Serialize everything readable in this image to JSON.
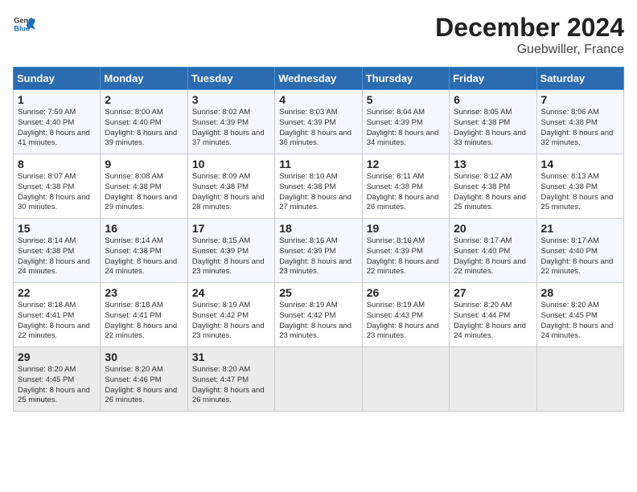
{
  "header": {
    "logo_text_general": "General",
    "logo_text_blue": "Blue",
    "month_title": "December 2024",
    "subtitle": "Guebwiller, France"
  },
  "calendar": {
    "days_of_week": [
      "Sunday",
      "Monday",
      "Tuesday",
      "Wednesday",
      "Thursday",
      "Friday",
      "Saturday"
    ],
    "weeks": [
      [
        {
          "day": "1",
          "sunrise": "Sunrise: 7:59 AM",
          "sunset": "Sunset: 4:40 PM",
          "daylight": "Daylight: 8 hours and 41 minutes."
        },
        {
          "day": "2",
          "sunrise": "Sunrise: 8:00 AM",
          "sunset": "Sunset: 4:40 PM",
          "daylight": "Daylight: 8 hours and 39 minutes."
        },
        {
          "day": "3",
          "sunrise": "Sunrise: 8:02 AM",
          "sunset": "Sunset: 4:39 PM",
          "daylight": "Daylight: 8 hours and 37 minutes."
        },
        {
          "day": "4",
          "sunrise": "Sunrise: 8:03 AM",
          "sunset": "Sunset: 4:39 PM",
          "daylight": "Daylight: 8 hours and 36 minutes."
        },
        {
          "day": "5",
          "sunrise": "Sunrise: 8:04 AM",
          "sunset": "Sunset: 4:39 PM",
          "daylight": "Daylight: 8 hours and 34 minutes."
        },
        {
          "day": "6",
          "sunrise": "Sunrise: 8:05 AM",
          "sunset": "Sunset: 4:38 PM",
          "daylight": "Daylight: 8 hours and 33 minutes."
        },
        {
          "day": "7",
          "sunrise": "Sunrise: 8:06 AM",
          "sunset": "Sunset: 4:38 PM",
          "daylight": "Daylight: 8 hours and 32 minutes."
        }
      ],
      [
        {
          "day": "8",
          "sunrise": "Sunrise: 8:07 AM",
          "sunset": "Sunset: 4:38 PM",
          "daylight": "Daylight: 8 hours and 30 minutes."
        },
        {
          "day": "9",
          "sunrise": "Sunrise: 8:08 AM",
          "sunset": "Sunset: 4:38 PM",
          "daylight": "Daylight: 8 hours and 29 minutes."
        },
        {
          "day": "10",
          "sunrise": "Sunrise: 8:09 AM",
          "sunset": "Sunset: 4:38 PM",
          "daylight": "Daylight: 8 hours and 28 minutes."
        },
        {
          "day": "11",
          "sunrise": "Sunrise: 8:10 AM",
          "sunset": "Sunset: 4:38 PM",
          "daylight": "Daylight: 8 hours and 27 minutes."
        },
        {
          "day": "12",
          "sunrise": "Sunrise: 8:11 AM",
          "sunset": "Sunset: 4:38 PM",
          "daylight": "Daylight: 8 hours and 26 minutes."
        },
        {
          "day": "13",
          "sunrise": "Sunrise: 8:12 AM",
          "sunset": "Sunset: 4:38 PM",
          "daylight": "Daylight: 8 hours and 25 minutes."
        },
        {
          "day": "14",
          "sunrise": "Sunrise: 8:13 AM",
          "sunset": "Sunset: 4:38 PM",
          "daylight": "Daylight: 8 hours and 25 minutes."
        }
      ],
      [
        {
          "day": "15",
          "sunrise": "Sunrise: 8:14 AM",
          "sunset": "Sunset: 4:38 PM",
          "daylight": "Daylight: 8 hours and 24 minutes."
        },
        {
          "day": "16",
          "sunrise": "Sunrise: 8:14 AM",
          "sunset": "Sunset: 4:38 PM",
          "daylight": "Daylight: 8 hours and 24 minutes."
        },
        {
          "day": "17",
          "sunrise": "Sunrise: 8:15 AM",
          "sunset": "Sunset: 4:39 PM",
          "daylight": "Daylight: 8 hours and 23 minutes."
        },
        {
          "day": "18",
          "sunrise": "Sunrise: 8:16 AM",
          "sunset": "Sunset: 4:39 PM",
          "daylight": "Daylight: 8 hours and 23 minutes."
        },
        {
          "day": "19",
          "sunrise": "Sunrise: 8:16 AM",
          "sunset": "Sunset: 4:39 PM",
          "daylight": "Daylight: 8 hours and 22 minutes."
        },
        {
          "day": "20",
          "sunrise": "Sunrise: 8:17 AM",
          "sunset": "Sunset: 4:40 PM",
          "daylight": "Daylight: 8 hours and 22 minutes."
        },
        {
          "day": "21",
          "sunrise": "Sunrise: 8:17 AM",
          "sunset": "Sunset: 4:40 PM",
          "daylight": "Daylight: 8 hours and 22 minutes."
        }
      ],
      [
        {
          "day": "22",
          "sunrise": "Sunrise: 8:18 AM",
          "sunset": "Sunset: 4:41 PM",
          "daylight": "Daylight: 8 hours and 22 minutes."
        },
        {
          "day": "23",
          "sunrise": "Sunrise: 8:18 AM",
          "sunset": "Sunset: 4:41 PM",
          "daylight": "Daylight: 8 hours and 22 minutes."
        },
        {
          "day": "24",
          "sunrise": "Sunrise: 8:19 AM",
          "sunset": "Sunset: 4:42 PM",
          "daylight": "Daylight: 8 hours and 23 minutes."
        },
        {
          "day": "25",
          "sunrise": "Sunrise: 8:19 AM",
          "sunset": "Sunset: 4:42 PM",
          "daylight": "Daylight: 8 hours and 23 minutes."
        },
        {
          "day": "26",
          "sunrise": "Sunrise: 8:19 AM",
          "sunset": "Sunset: 4:43 PM",
          "daylight": "Daylight: 8 hours and 23 minutes."
        },
        {
          "day": "27",
          "sunrise": "Sunrise: 8:20 AM",
          "sunset": "Sunset: 4:44 PM",
          "daylight": "Daylight: 8 hours and 24 minutes."
        },
        {
          "day": "28",
          "sunrise": "Sunrise: 8:20 AM",
          "sunset": "Sunset: 4:45 PM",
          "daylight": "Daylight: 8 hours and 24 minutes."
        }
      ],
      [
        {
          "day": "29",
          "sunrise": "Sunrise: 8:20 AM",
          "sunset": "Sunset: 4:45 PM",
          "daylight": "Daylight: 8 hours and 25 minutes."
        },
        {
          "day": "30",
          "sunrise": "Sunrise: 8:20 AM",
          "sunset": "Sunset: 4:46 PM",
          "daylight": "Daylight: 8 hours and 26 minutes."
        },
        {
          "day": "31",
          "sunrise": "Sunrise: 8:20 AM",
          "sunset": "Sunset: 4:47 PM",
          "daylight": "Daylight: 8 hours and 26 minutes."
        },
        {
          "day": "",
          "sunrise": "",
          "sunset": "",
          "daylight": ""
        },
        {
          "day": "",
          "sunrise": "",
          "sunset": "",
          "daylight": ""
        },
        {
          "day": "",
          "sunrise": "",
          "sunset": "",
          "daylight": ""
        },
        {
          "day": "",
          "sunrise": "",
          "sunset": "",
          "daylight": ""
        }
      ]
    ]
  }
}
